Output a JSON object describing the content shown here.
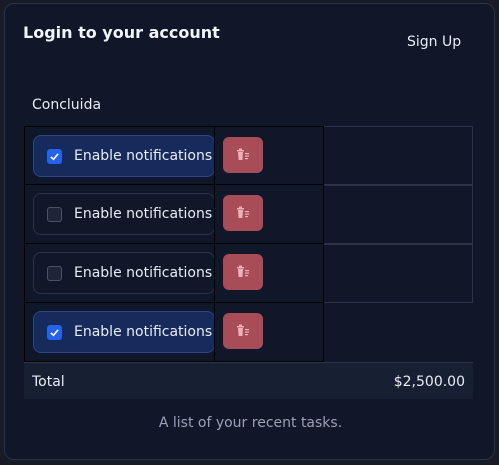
{
  "header": {
    "title": "Login to your account",
    "signup_label": "Sign Up"
  },
  "status_label": "Concluida",
  "rows": [
    {
      "label": "Enable notifications",
      "checked": true
    },
    {
      "label": "Enable notifications",
      "checked": false
    },
    {
      "label": "Enable notifications",
      "checked": false
    },
    {
      "label": "Enable notifications",
      "checked": true
    }
  ],
  "footer": {
    "total_label": "Total",
    "total_value": "$2,500.00"
  },
  "caption": "A list of your recent tasks.",
  "colors": {
    "accent": "#2563eb",
    "danger": "#a84d57",
    "card_bg": "#0f1728"
  },
  "icons": {
    "checkbox": "check-icon",
    "delete": "trash-icon"
  }
}
